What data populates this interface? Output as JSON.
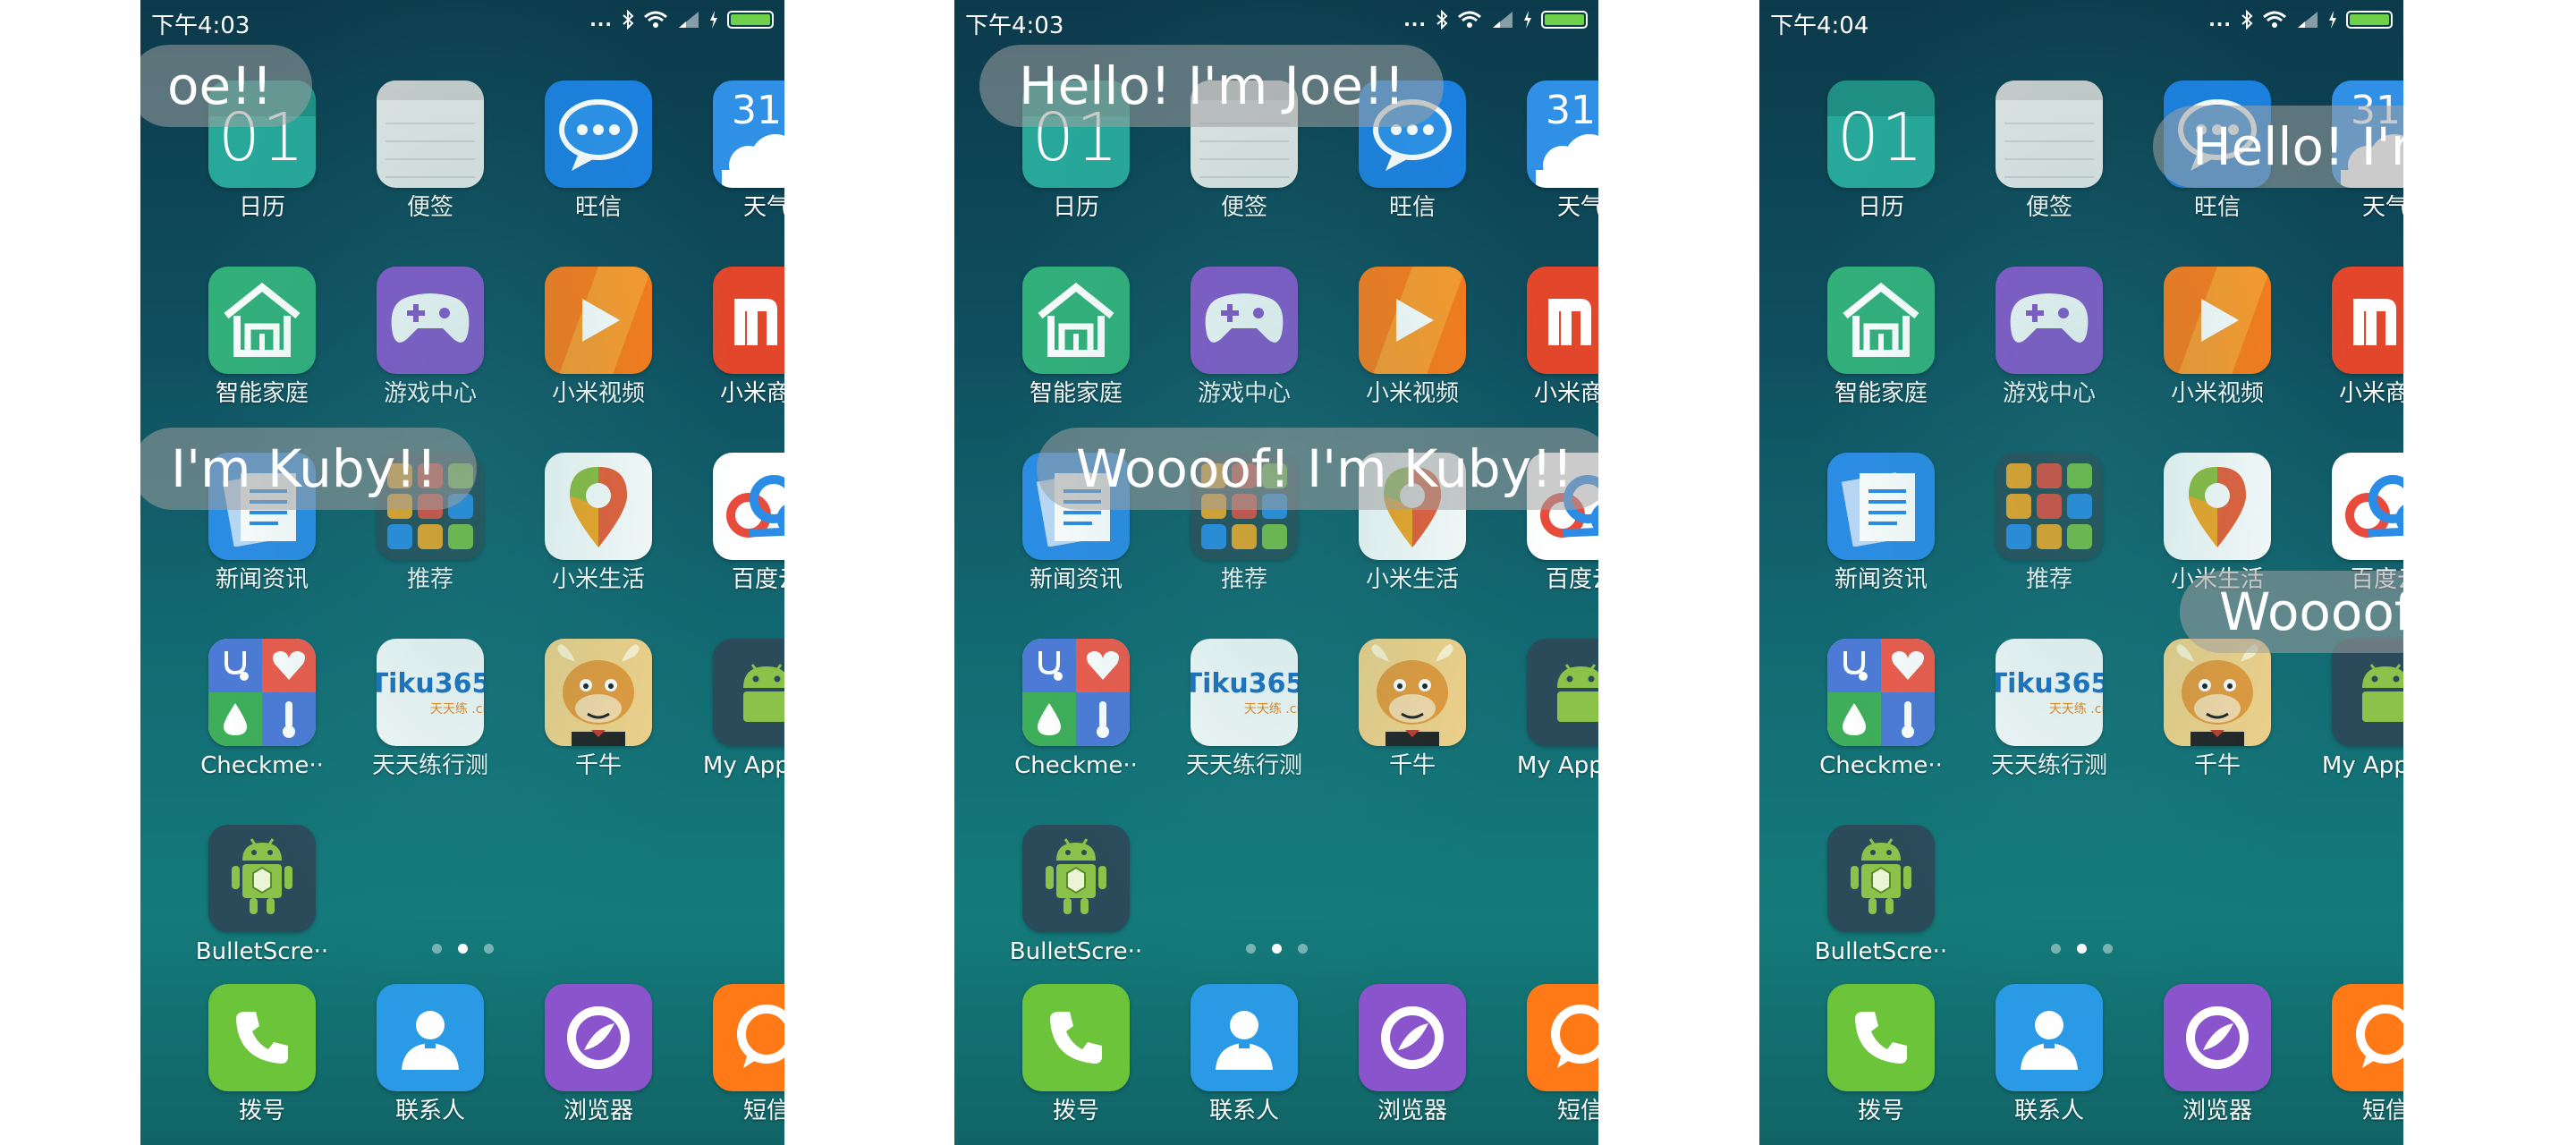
{
  "screens": [
    {
      "status": {
        "time": "下午4:03",
        "dots": "..."
      },
      "bullets": [
        "oe!!",
        "I'm Kuby!!"
      ]
    },
    {
      "status": {
        "time": "下午4:03",
        "dots": "..."
      },
      "bullets": [
        "Hello! I'm Joe!!",
        "Woooof! I'm Kuby!!"
      ]
    },
    {
      "status": {
        "time": "下午4:04",
        "dots": "..."
      },
      "bullets": [
        "Hello! I'm",
        "Woooof!"
      ]
    }
  ],
  "apps": [
    {
      "label": "日历",
      "icon": "calendar-icon",
      "color": "#27a89a",
      "glyph": "01"
    },
    {
      "label": "便签",
      "icon": "notes-icon",
      "color": "#e8e8e8",
      "glyph": ""
    },
    {
      "label": "旺信",
      "icon": "chat-bubble-icon",
      "color": "#1b7fe0",
      "glyph": ""
    },
    {
      "label": "天气",
      "icon": "weather-icon",
      "color": "#2f90e6",
      "glyph": "31°"
    },
    {
      "label": "智能家庭",
      "icon": "smart-home-icon",
      "color": "#32b07a",
      "glyph": ""
    },
    {
      "label": "游戏中心",
      "icon": "gamepad-icon",
      "color": "#8a55cc",
      "glyph": ""
    },
    {
      "label": "小米视频",
      "icon": "play-icon",
      "color": "#ff7a17",
      "glyph": ""
    },
    {
      "label": "小米商城",
      "icon": "mi-logo-icon",
      "color": "#e2472b",
      "glyph": ""
    },
    {
      "label": "新闻资讯",
      "icon": "news-icon",
      "color": "#2b8ce6",
      "glyph": ""
    },
    {
      "label": "推荐",
      "icon": "app-folder-icon",
      "color": "#264a55",
      "glyph": ""
    },
    {
      "label": "小米生活",
      "icon": "map-pin-icon",
      "color": "#ffffff",
      "glyph": ""
    },
    {
      "label": "百度云",
      "icon": "cloud-link-icon",
      "color": "#ffffff",
      "glyph": ""
    },
    {
      "label": "Checkme··",
      "icon": "health-icon",
      "color": "#ffffff",
      "glyph": ""
    },
    {
      "label": "天天练行测",
      "icon": "tiku-icon",
      "color": "#ffffff",
      "glyph": "Tiku365"
    },
    {
      "label": "千牛",
      "icon": "cow-mascot-icon",
      "color": "#f0a63a",
      "glyph": ""
    },
    {
      "label": "My Applic··",
      "icon": "android-icon",
      "color": "#2b4a5a",
      "glyph": ""
    },
    {
      "label": "BulletScre··",
      "icon": "android-box-icon",
      "color": "#2b4a5a",
      "glyph": ""
    }
  ],
  "dock": [
    {
      "label": "拨号",
      "icon": "phone-icon",
      "color": "#6cc43a"
    },
    {
      "label": "联系人",
      "icon": "contacts-icon",
      "color": "#2b9ae6"
    },
    {
      "label": "浏览器",
      "icon": "browser-icon",
      "color": "#8a55cc"
    },
    {
      "label": "短信",
      "icon": "message-icon",
      "color": "#ff7a17"
    }
  ],
  "pager": {
    "pages": 3,
    "active": 2
  }
}
